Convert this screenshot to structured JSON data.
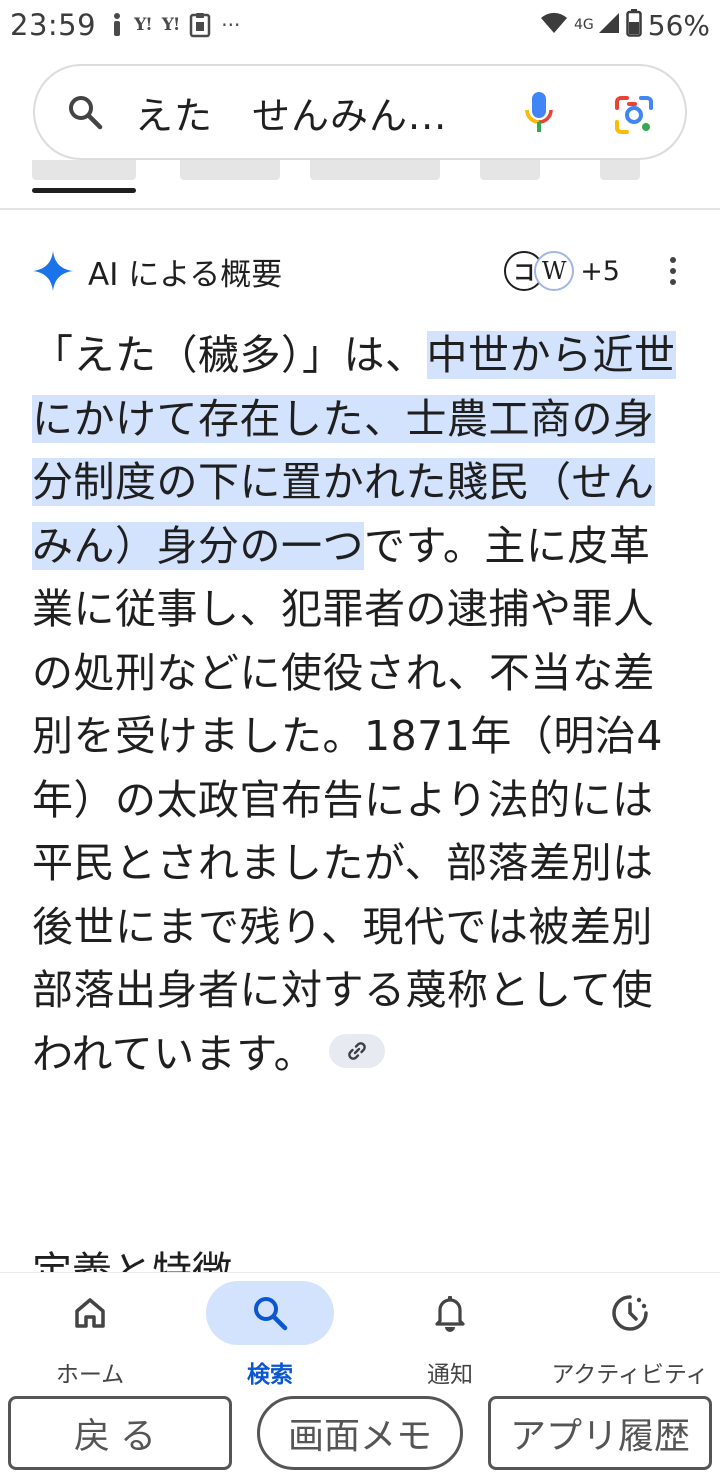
{
  "status_bar": {
    "time": "23:59",
    "left_icons": [
      "info-icon",
      "yahoo-icon",
      "yahoo-icon",
      "clipboard-icon",
      "more-icon"
    ],
    "yahoo_label": "Y!",
    "more": "···",
    "network": "4G",
    "battery": "56%"
  },
  "search": {
    "query": "えた　せんみん..."
  },
  "ai_overview": {
    "title": "AI による概要",
    "source_1": "コ",
    "source_2": "W",
    "more_sources": "+5",
    "text_before": "「えた（穢多）」は、",
    "text_highlight": "中世から近世にかけて存在した、士農工商の身分制度の下に置かれた賤民（せんみん）身分の一つ",
    "text_after": "です。主に皮革業に従事し、犯罪者の逮捕や罪人の処刑などに使役され、不当な差別を受けました。1871年（明治4年）の太政官布告により法的には平民とされましたが、部落差別は後世にまで残り、現代では被差別部落出身者に対する蔑称として使われています。",
    "next_heading": "定義と特徴"
  },
  "bottom_nav": {
    "items": [
      {
        "label": "ホーム",
        "icon": "home-icon"
      },
      {
        "label": "検索",
        "icon": "search-icon",
        "active": true
      },
      {
        "label": "通知",
        "icon": "bell-icon"
      },
      {
        "label": "アクティビティ",
        "icon": "activity-icon"
      }
    ]
  },
  "system_buttons": {
    "back": "戻る",
    "memo": "画面メモ",
    "history": "アプリ履歴"
  },
  "colors": {
    "highlight": "#d3e3fd",
    "active_nav": "#0b57d0",
    "sparkle": "#1a73e8"
  }
}
